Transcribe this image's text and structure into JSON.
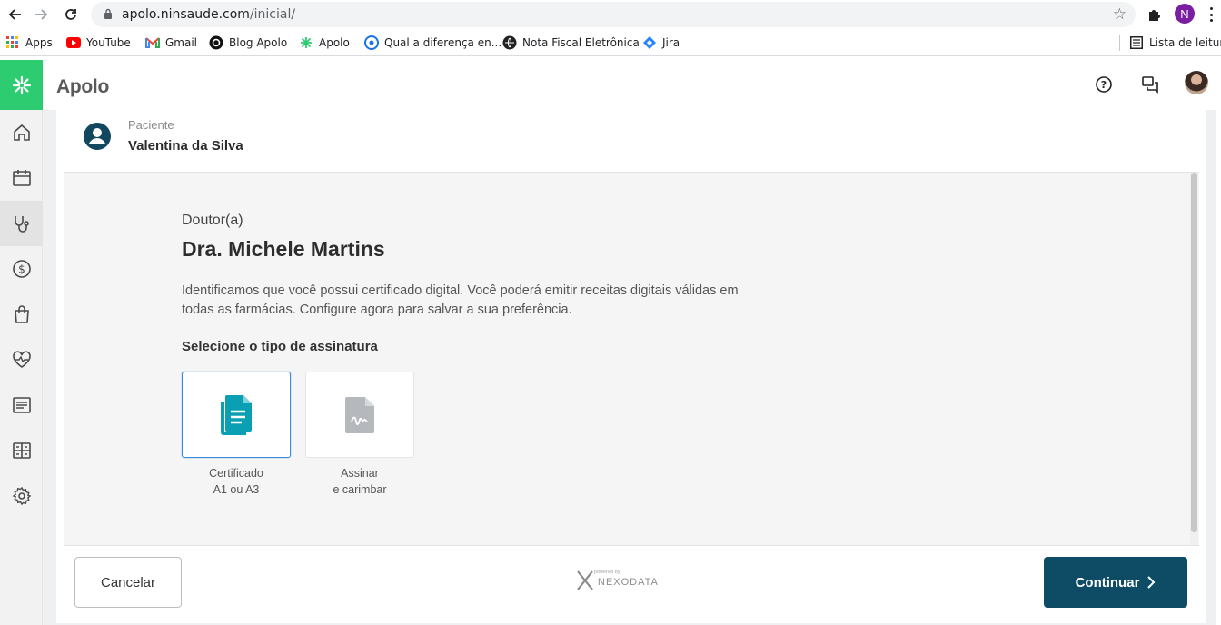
{
  "browser": {
    "url_host": "apolo.ninsaude.com",
    "url_path": "/inicial/",
    "profile_initial": "N"
  },
  "bookmarks": [
    {
      "label": "Apps",
      "icon": "apps-grid-icon"
    },
    {
      "label": "YouTube",
      "icon": "youtube-icon"
    },
    {
      "label": "Gmail",
      "icon": "gmail-icon"
    },
    {
      "label": "Blog Apolo",
      "icon": "blog-icon"
    },
    {
      "label": "Apolo",
      "icon": "apolo-icon"
    },
    {
      "label": "Qual a diferença en...",
      "icon": "globe-icon"
    },
    {
      "label": "Nota Fiscal Eletrônica",
      "icon": "nfe-icon"
    },
    {
      "label": "Jira",
      "icon": "jira-icon"
    }
  ],
  "reading_list": "Lista de leitura",
  "app": {
    "title": "Apolo",
    "brand_color": "#2ecc71"
  },
  "sidebar": {
    "items": [
      {
        "icon": "home-icon"
      },
      {
        "icon": "calendar-icon"
      },
      {
        "icon": "stethoscope-icon",
        "active": true
      },
      {
        "icon": "dollar-icon"
      },
      {
        "icon": "shopping-bag-icon"
      },
      {
        "icon": "heart-pulse-icon"
      },
      {
        "icon": "report-icon"
      },
      {
        "icon": "dashboard-icon"
      },
      {
        "icon": "settings-icon"
      }
    ]
  },
  "patient": {
    "label": "Paciente",
    "name": "Valentina da Silva"
  },
  "modal": {
    "doctor_label": "Doutor(a)",
    "doctor_name": "Dra. Michele Martins",
    "description": "Identificamos que você possui certificado digital. Você poderá emitir receitas digitais válidas em todas as farmácias. Configure agora para salvar a sua preferência.",
    "select_label": "Selecione o tipo de assinatura",
    "options": [
      {
        "line1": "Certificado",
        "line2": "A1 ou A3",
        "selected": true
      },
      {
        "line1": "Assinar",
        "line2": "e carimbar",
        "selected": false
      }
    ]
  },
  "footer": {
    "cancel_label": "Cancelar",
    "continue_label": "Continuar",
    "powered_by": "powered by",
    "partner": "NEXODATA"
  }
}
